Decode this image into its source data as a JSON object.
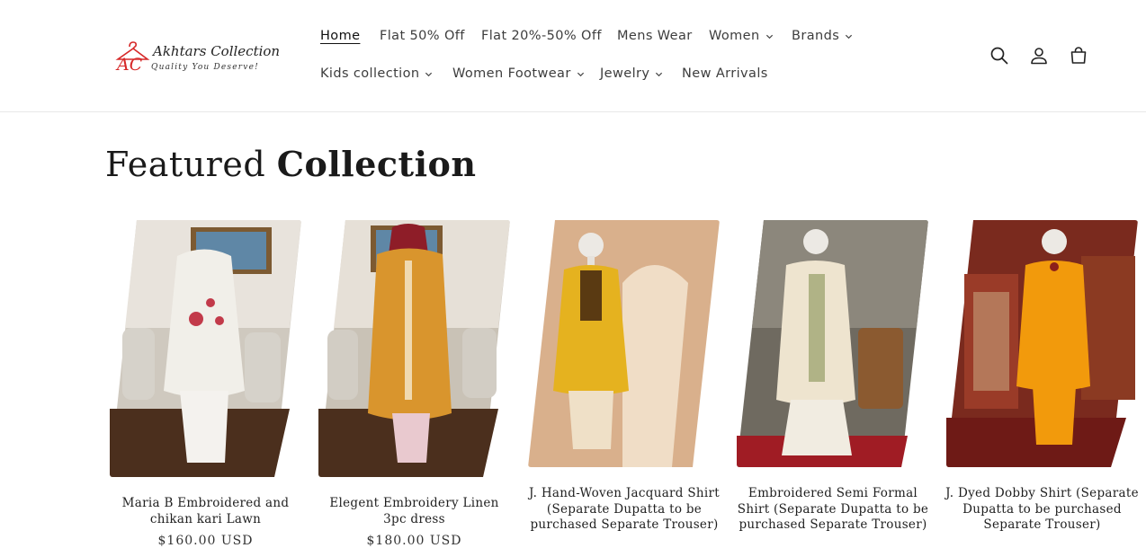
{
  "brand": {
    "monogram": "AC",
    "name": "Akhtars Collection",
    "tagline": "Quality You Deserve!"
  },
  "nav": [
    {
      "label": "Home",
      "active": true,
      "dropdown": false
    },
    {
      "label": "Flat 50% Off",
      "dropdown": false
    },
    {
      "label": "Flat 20%-50% Off",
      "dropdown": false
    },
    {
      "label": "Mens Wear",
      "dropdown": false
    },
    {
      "label": "Women",
      "dropdown": true
    },
    {
      "label": "Brands",
      "dropdown": true
    },
    {
      "label": "Kids collection",
      "dropdown": true
    },
    {
      "label": "Women Footwear",
      "dropdown": true
    },
    {
      "label": "Jewelry",
      "dropdown": true
    },
    {
      "label": "New Arrivals",
      "dropdown": false
    }
  ],
  "header_icons": [
    "search-icon",
    "account-icon",
    "cart-icon"
  ],
  "section": {
    "title_regular": "Featured",
    "title_bold": "Collection"
  },
  "products": [
    {
      "title": "Maria B Embroidered and chikan kari Lawn",
      "price": "$160.00 USD",
      "outfit_color": "#f1efe9",
      "accent_color": "#c23a4a"
    },
    {
      "title": "Elegent Embroidery Linen 3pc dress",
      "price": "$180.00 USD",
      "outfit_color": "#d9952d",
      "accent_color": "#8e1d28"
    },
    {
      "title": "J. Hand-Woven Jacquard Shirt (Separate Dupatta to be purchased Separate Trouser)",
      "price": "",
      "outfit_color": "#e5b21f",
      "accent_color": "#5a3a12"
    },
    {
      "title": "Embroidered Semi Formal Shirt (Separate Dupatta to be purchased Separate Trouser)",
      "price": "",
      "outfit_color": "#eee4cf",
      "accent_color": "#7e8a4a"
    },
    {
      "title": "J. Dyed Dobby Shirt (Separate Dupatta to be purchased Separate Trouser)",
      "price": "",
      "outfit_color": "#f29a0c",
      "accent_color": "#8c1f1a"
    }
  ],
  "colors": {
    "text": "#222222",
    "border": "#e8e8e8",
    "brand_red": "#d62828"
  }
}
